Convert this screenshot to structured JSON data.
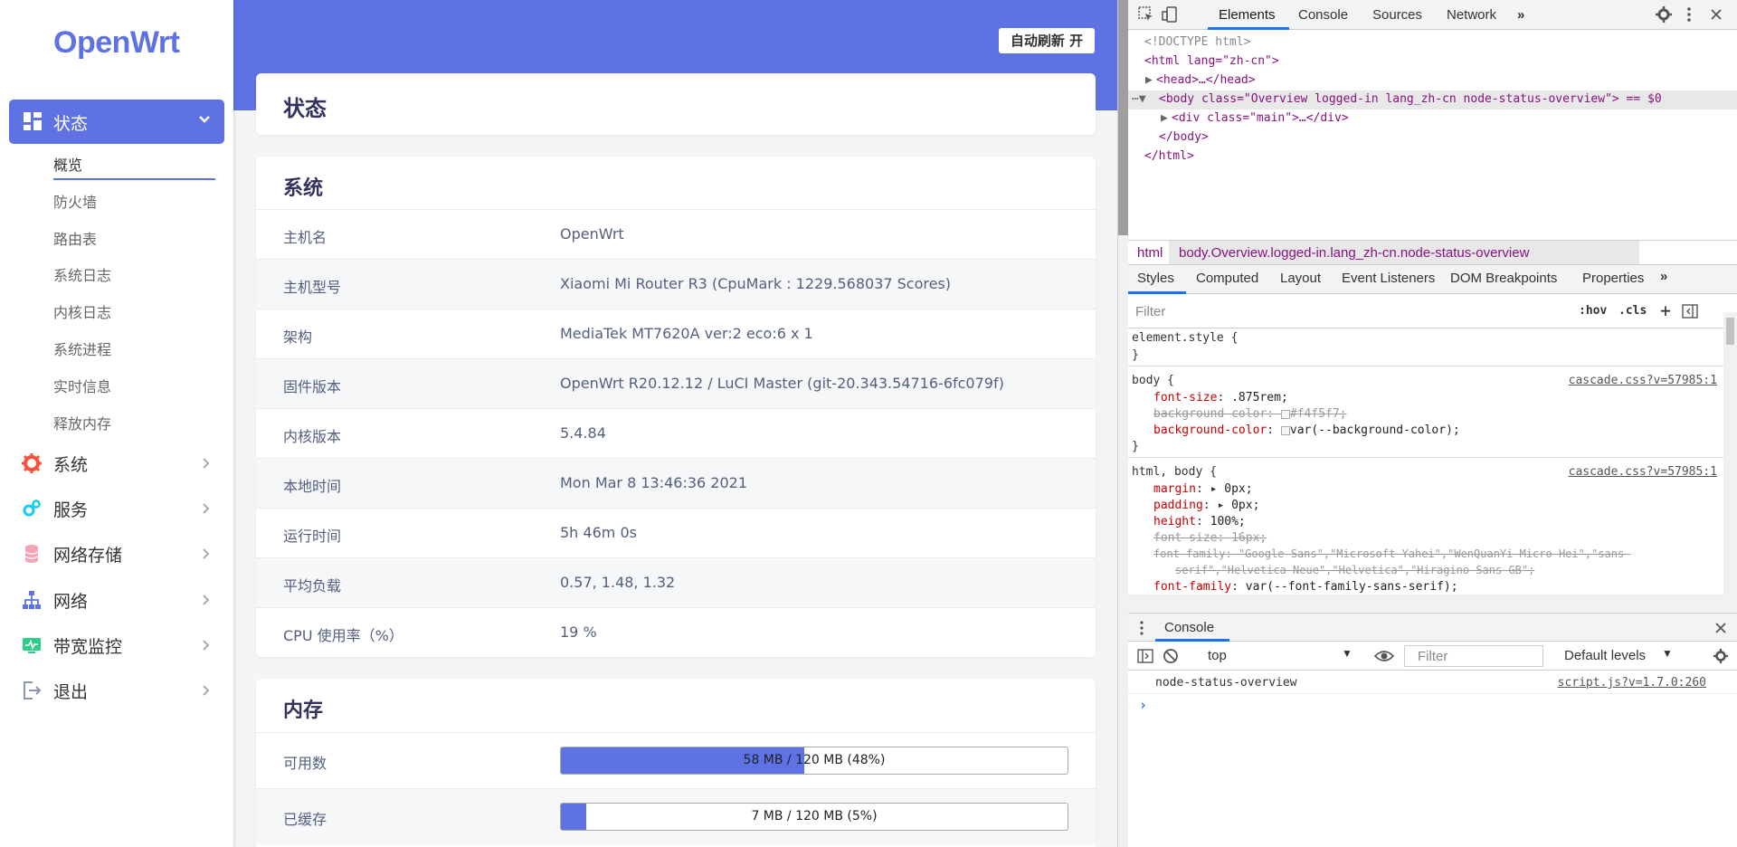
{
  "sidebar": {
    "logo": "OpenWrt",
    "active_menu": "状态",
    "sub_items": [
      "概览",
      "防火墙",
      "路由表",
      "系统日志",
      "内核日志",
      "系统进程",
      "实时信息",
      "释放内存"
    ],
    "menus": [
      {
        "label": "系统",
        "icon": "gear-icon",
        "color": "#f5533d"
      },
      {
        "label": "服务",
        "icon": "gears-icon",
        "color": "#11cdef"
      },
      {
        "label": "网络存储",
        "icon": "database-icon",
        "color": "#f3a4b5"
      },
      {
        "label": "网络",
        "icon": "sitemap-icon",
        "color": "#5e72e4"
      },
      {
        "label": "带宽监控",
        "icon": "monitor-icon",
        "color": "#2dce89"
      },
      {
        "label": "退出",
        "icon": "logout-icon",
        "color": "#8898aa"
      }
    ]
  },
  "main": {
    "refresh_label": "自动刷新 开",
    "page_title": "状态",
    "system": {
      "title": "系统",
      "rows": [
        {
          "k": "主机名",
          "v": "OpenWrt"
        },
        {
          "k": "主机型号",
          "v": "Xiaomi Mi Router R3 (CpuMark : 1229.568037 Scores)"
        },
        {
          "k": "架构",
          "v": "MediaTek MT7620A ver:2 eco:6 x 1"
        },
        {
          "k": "固件版本",
          "v": "OpenWrt R20.12.12 / LuCI Master (git-20.343.54716-6fc079f)"
        },
        {
          "k": "内核版本",
          "v": "5.4.84"
        },
        {
          "k": "本地时间",
          "v": "Mon Mar 8 13:46:36 2021"
        },
        {
          "k": "运行时间",
          "v": "5h 46m 0s"
        },
        {
          "k": "平均负载",
          "v": "0.57, 1.48, 1.32"
        },
        {
          "k": "CPU 使用率（%）",
          "v": "19 %"
        }
      ]
    },
    "memory": {
      "title": "内存",
      "rows": [
        {
          "k": "可用数",
          "text": "58 MB / 120 MB (48%)",
          "percent": 48
        },
        {
          "k": "已缓存",
          "text": "7 MB / 120 MB (5%)",
          "percent": 5
        }
      ]
    },
    "accent": "#5e72e4"
  },
  "devtools": {
    "tabs": [
      "Elements",
      "Console",
      "Sources",
      "Network"
    ],
    "active_tab": "Elements",
    "dom": {
      "doctype": "<!DOCTYPE html>",
      "html_open": "<html lang=\"zh-cn\">",
      "head": "<head>…</head>",
      "body_open": "<body class=\"Overview logged-in lang_zh-cn node-status-overview\"> == $0",
      "div_main": "<div class=\"main\">…</div>",
      "body_close": "</body>",
      "html_close": "</html>"
    },
    "breadcrumbs": [
      "html",
      "body.Overview.logged-in.lang_zh-cn.node-status-overview"
    ],
    "style_tabs": [
      "Styles",
      "Computed",
      "Layout",
      "Event Listeners",
      "DOM Breakpoints",
      "Properties"
    ],
    "filter_placeholder": "Filter",
    "hov": ":hov",
    "cls": ".cls",
    "rules": {
      "element_style": "element.style {",
      "body_selector": "body {",
      "body_link": "cascade.css?v=57985:1",
      "body_props": [
        {
          "p": "font-size",
          "v": ".875rem;",
          "struck": false
        },
        {
          "p": "background-color",
          "v": "#f4f5f7;",
          "struck": true
        },
        {
          "p": "background-color",
          "v": "var(--background-color);",
          "struck": false
        }
      ],
      "html_body_selector": "html, body {",
      "html_body_link": "cascade.css?v=57985:1",
      "html_body_props": [
        {
          "p": "margin",
          "v": "0px;",
          "struck": false
        },
        {
          "p": "padding",
          "v": "0px;",
          "struck": false
        },
        {
          "p": "height",
          "v": "100%;",
          "struck": false
        },
        {
          "p": "font-size",
          "v": "16px;",
          "struck": true
        },
        {
          "p": "font-family",
          "v": "\"Google Sans\",\"Microsoft Yahei\",\"WenQuanYi Micro Hei\",\"sans-",
          "struck": true
        },
        {
          "p": "",
          "v": "serif\",\"Helvetica Neue\",\"Helvetica\",\"Hiragino Sans GB\";",
          "struck": true
        },
        {
          "p": "font-family",
          "v": "var(--font-family-sans-serif);",
          "struck": false
        }
      ]
    },
    "console": {
      "tab": "Console",
      "context": "top",
      "filter_placeholder": "Filter",
      "levels": "Default levels",
      "log_text": "node-status-overview",
      "log_source": "script.js?v=1.7.0:260"
    }
  }
}
